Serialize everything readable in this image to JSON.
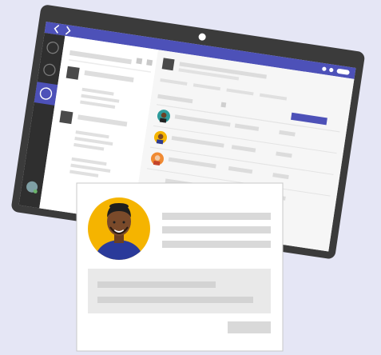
{
  "illustration": {
    "tablet": {
      "nav_back_icon": "chevron-left-icon",
      "nav_forward_icon": "chevron-right-icon",
      "camera_icon": "camera-dot-icon",
      "window_controls_icon": "window-controls-icon",
      "rail_items": [
        "rail-circle-icon",
        "rail-circle-icon",
        "rail-circle-icon"
      ],
      "active_rail_index": 2,
      "list_rows": 3,
      "contact_rows": 3,
      "text": []
    },
    "profile_card": {
      "avatar_icon": "person-avatar-icon",
      "text_lines": 3,
      "text": []
    }
  },
  "colors": {
    "background": "#e5e6f5",
    "device_frame": "#3b3b3b",
    "titlebar": "#4d51b8",
    "rail": "#2f2f2f",
    "active_rail": "#4d51b8",
    "panel": "#f4f4f4",
    "placeholder": "#d9d9d9",
    "avatar_bg": "#f5b400",
    "accent_button": "#4d51b8",
    "card_border": "#c8c8c8"
  }
}
